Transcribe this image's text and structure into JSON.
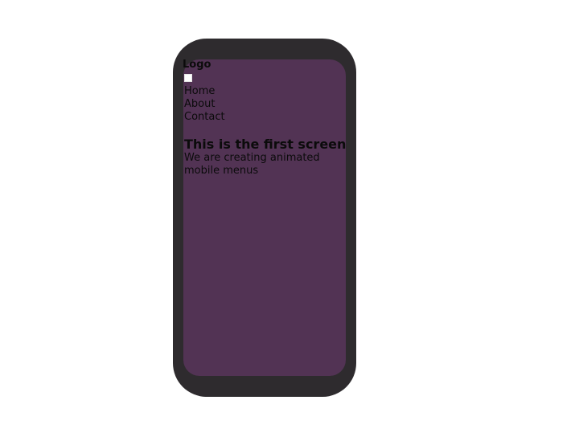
{
  "header": {
    "logo_text": "Logo"
  },
  "nav": {
    "items": [
      {
        "label": "Home"
      },
      {
        "label": "About"
      },
      {
        "label": "Contact"
      }
    ]
  },
  "main": {
    "title": "This is the first screen",
    "subtitle": "We are creating animated mobile menus"
  },
  "colors": {
    "frame": "#2e2b2e",
    "screen": "#523354",
    "text": "#0b0b0b",
    "page_background": "#ffffff"
  }
}
